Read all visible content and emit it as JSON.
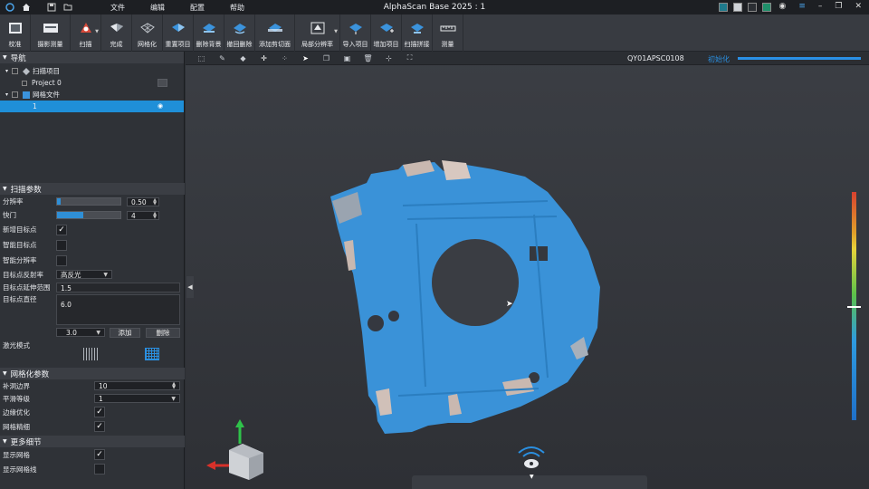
{
  "app": {
    "title": "AlphaScan Base 2025 : 1",
    "menu": [
      "文件",
      "编辑",
      "配置",
      "帮助"
    ],
    "title_icons": [
      "app-logo-icon",
      "home-icon",
      "save-icon",
      "folder-icon"
    ],
    "swatches": [
      "#1f7a8c",
      "#cfd3d8",
      "#2b2e33",
      "#1f8f6a"
    ],
    "window_controls": [
      "globe-icon",
      "menu-icon",
      "minimize-icon",
      "restore-icon",
      "close-icon"
    ]
  },
  "toolbar": {
    "buttons": [
      {
        "label": "校准",
        "icon": "calibrate-icon"
      },
      {
        "label": "摄影测量",
        "icon": "photogrammetry-icon"
      },
      {
        "label": "扫描",
        "icon": "scan-icon"
      },
      {
        "label": "完成",
        "icon": "finish-icon"
      },
      {
        "label": "网格化",
        "icon": "mesh-icon"
      },
      {
        "label": "重置项目",
        "icon": "reset-project-icon"
      },
      {
        "label": "删除背景",
        "icon": "delete-background-icon"
      },
      {
        "label": "撤回删除",
        "icon": "undo-delete-icon"
      },
      {
        "label": "添加剪切面",
        "icon": "add-clip-plane-icon"
      },
      {
        "label": "局部分辨率",
        "icon": "local-resolution-icon"
      },
      {
        "label": "导入项目",
        "icon": "import-project-icon"
      },
      {
        "label": "增加项目",
        "icon": "add-project-icon"
      },
      {
        "label": "扫描拼接",
        "icon": "scan-stitch-icon"
      },
      {
        "label": "测量",
        "icon": "measure-icon"
      }
    ]
  },
  "navigation": {
    "title": "导航",
    "scan_project": "扫描项目",
    "project_name": "Project 0",
    "mesh_file": "网格文件",
    "mesh_item": "1"
  },
  "scan_params": {
    "title": "扫描参数",
    "resolution_label": "分辨率",
    "resolution_value": "0.50",
    "resolution_fill": 0.05,
    "exposure_label": "快门",
    "exposure_value": "4",
    "exposure_fill": 0.42,
    "new_marker_label": "新增目标点",
    "new_marker_checked": true,
    "smart_marker_label": "智能目标点",
    "smart_marker_checked": false,
    "smart_resolution_label": "智能分辨率",
    "smart_resolution_checked": false,
    "reflectivity_label": "目标点反射率",
    "reflectivity_value": "高反光",
    "extend_label": "目标点延伸范围",
    "extend_value": "1.5",
    "diameter_label": "目标点直径",
    "diameter_value": "6.0",
    "diameter_select": "3.0",
    "add_label": "添加",
    "delete_label": "删除",
    "laser_mode_label": "激光模式"
  },
  "mesh_params": {
    "title": "网格化参数",
    "fill_holes_label": "补洞边界",
    "fill_holes_value": "10",
    "smooth_label": "平滑等级",
    "smooth_value": "1",
    "edge_opt_label": "边缘优化",
    "edge_opt_checked": true,
    "mesh_refine_label": "网格精细",
    "mesh_refine_checked": true
  },
  "more_details": {
    "title": "更多细节",
    "show_mesh_label": "显示网格",
    "show_mesh_checked": true,
    "show_wire_label": "显示网格线",
    "show_wire_checked": false
  },
  "viewport": {
    "device_id": "QY01APSC0108",
    "status": "初始化",
    "progress": 1.0,
    "model_color": "#3a92d8",
    "tool_icons": [
      "select-icon",
      "lasso-icon",
      "brush-icon",
      "pan-icon",
      "points-icon",
      "select-through-icon",
      "copy-icon",
      "layers-icon",
      "delete-icon",
      "focus-icon",
      "fit-icon"
    ]
  }
}
